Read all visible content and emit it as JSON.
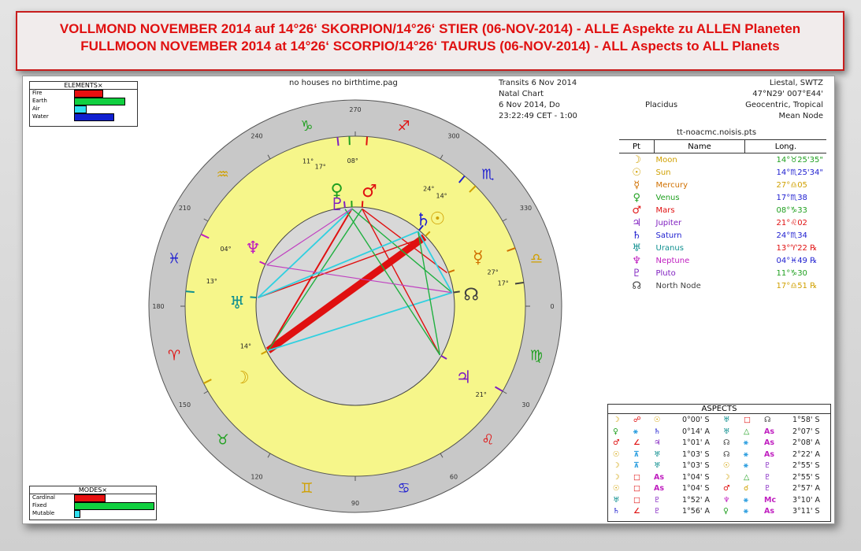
{
  "banner": {
    "line1": "VOLLMOND NOVEMBER 2014 auf 14°26‘ SKORPION/14°26‘ STIER (06-NOV-2014) - ALLE Aspekte zu ALLEN Planeten",
    "line2": "FULLMOON NOVEMBER 2014 at 14°26‘ SCORPIO/14°26‘ TAURUS (06-NOV-2014) - ALL Aspects to ALL Planets"
  },
  "chart_header": {
    "filename": "no houses no birthtime.pag",
    "left_lines": [
      "Transits 6 Nov 2014",
      "Natal Chart",
      "6 Nov 2014, Do",
      "23:22:49 CET - 1:00"
    ],
    "house_system": "Placidus",
    "right_lines": [
      "Liestal, SWTZ",
      "47°N29' 007°E44'",
      "Geocentric, Tropical",
      "Mean Node"
    ]
  },
  "elements": {
    "title": "ELEMENTS×",
    "items": [
      {
        "label": "Fire",
        "value": 0.42,
        "color": "#e81010"
      },
      {
        "label": "Earth",
        "value": 0.75,
        "color": "#10d040"
      },
      {
        "label": "Air",
        "value": 0.17,
        "color": "#30e0f0"
      },
      {
        "label": "Water",
        "value": 0.58,
        "color": "#1020d0"
      }
    ]
  },
  "modes": {
    "title": "MODES×",
    "items": [
      {
        "label": "Cardinal",
        "value": 0.38,
        "color": "#e81010"
      },
      {
        "label": "Fixed",
        "value": 1.0,
        "color": "#10d040"
      },
      {
        "label": "Mutable",
        "value": 0.06,
        "color": "#30e0f0"
      }
    ]
  },
  "wheel": {
    "degree_labels": [
      "270",
      "300",
      "330",
      "0",
      "30",
      "60",
      "90",
      "120",
      "150",
      "180",
      "210",
      "240"
    ],
    "signs": [
      {
        "glyph": "♈",
        "color": "#e01010"
      },
      {
        "glyph": "♉",
        "color": "#20a020"
      },
      {
        "glyph": "♊",
        "color": "#d0a000"
      },
      {
        "glyph": "♋",
        "color": "#2020d0"
      },
      {
        "glyph": "♌",
        "color": "#e01010"
      },
      {
        "glyph": "♍",
        "color": "#20a020"
      },
      {
        "glyph": "♎",
        "color": "#d0a000"
      },
      {
        "glyph": "♏",
        "color": "#2020d0"
      },
      {
        "glyph": "♐",
        "color": "#e01010"
      },
      {
        "glyph": "♑",
        "color": "#20a020"
      },
      {
        "glyph": "♒",
        "color": "#d0a000"
      },
      {
        "glyph": "♓",
        "color": "#2020d0"
      }
    ],
    "planets": [
      {
        "name": "Moon",
        "glyph": "☽",
        "deg": "14°",
        "color": "#d0a000"
      },
      {
        "name": "Sun",
        "glyph": "☉",
        "deg": "14°",
        "color": "#d0a000"
      },
      {
        "name": "Mercury",
        "glyph": "☿",
        "deg": "27°",
        "color": "#d07000"
      },
      {
        "name": "Venus",
        "glyph": "♀",
        "deg": "17°",
        "color": "#20a020"
      },
      {
        "name": "Mars",
        "glyph": "♂",
        "deg": "08°",
        "color": "#e01010"
      },
      {
        "name": "Jupiter",
        "glyph": "♃",
        "deg": "21°",
        "color": "#8020c0"
      },
      {
        "name": "Saturn",
        "glyph": "♄",
        "deg": "24°",
        "color": "#2020d0"
      },
      {
        "name": "Uranus",
        "glyph": "♅",
        "deg": "13°",
        "color": "#109090"
      },
      {
        "name": "Neptune",
        "glyph": "♆",
        "deg": "04°",
        "color": "#c020c0"
      },
      {
        "name": "Pluto",
        "glyph": "♇",
        "deg": "11°",
        "color": "#8020c0"
      },
      {
        "name": "North Node",
        "glyph": "☊",
        "deg": "17°",
        "color": "#404040"
      }
    ]
  },
  "planet_table": {
    "title": "tt-noacmc.noisis.pts",
    "headers": [
      "Pt",
      "Name",
      "Long."
    ],
    "rows": [
      {
        "glyph": "☽",
        "name": "Moon",
        "long": "14°♉25'35\"",
        "color": "#d0a000",
        "lcolor": "#20a020"
      },
      {
        "glyph": "☉",
        "name": "Sun",
        "long": "14°♏25'34\"",
        "color": "#d0a000",
        "lcolor": "#2020d0"
      },
      {
        "glyph": "☿",
        "name": "Mercury",
        "long": "27°♎05",
        "color": "#d07000",
        "lcolor": "#d0a000"
      },
      {
        "glyph": "♀",
        "name": "Venus",
        "long": "17°♏38",
        "color": "#20a020",
        "lcolor": "#2020d0"
      },
      {
        "glyph": "♂",
        "name": "Mars",
        "long": "08°♑33",
        "color": "#e01010",
        "lcolor": "#20a020"
      },
      {
        "glyph": "♃",
        "name": "Jupiter",
        "long": "21°♌02",
        "color": "#8020c0",
        "lcolor": "#e01010"
      },
      {
        "glyph": "♄",
        "name": "Saturn",
        "long": "24°♏34",
        "color": "#2020d0",
        "lcolor": "#2020d0"
      },
      {
        "glyph": "♅",
        "name": "Uranus",
        "long": "13°♈22 ℞",
        "color": "#109090",
        "lcolor": "#e01010"
      },
      {
        "glyph": "♆",
        "name": "Neptune",
        "long": "04°♓49 ℞",
        "color": "#c020c0",
        "lcolor": "#2020d0"
      },
      {
        "glyph": "♇",
        "name": "Pluto",
        "long": "11°♑30",
        "color": "#8020c0",
        "lcolor": "#20a020"
      },
      {
        "glyph": "☊",
        "name": "North Node",
        "long": "17°♎51 ℞",
        "color": "#404040",
        "lcolor": "#d0a000"
      }
    ]
  },
  "aspects": {
    "title": "ASPECTS",
    "left": [
      [
        "☽",
        "☍",
        "☉",
        "0°00' S"
      ],
      [
        "♀",
        "⚹",
        "♄",
        "0°14' A"
      ],
      [
        "♂",
        "∠",
        "♃",
        "1°01' A"
      ],
      [
        "☉",
        "⊼",
        "♅",
        "1°03' S"
      ],
      [
        "☽",
        "⊼",
        "♅",
        "1°03' S"
      ],
      [
        "☽",
        "□",
        "As",
        "1°04' S"
      ],
      [
        "☉",
        "□",
        "As",
        "1°04' S"
      ],
      [
        "♅",
        "□",
        "♇",
        "1°52' A"
      ],
      [
        "♄",
        "∠",
        "♇",
        "1°56' A"
      ]
    ],
    "right": [
      [
        "♅",
        "□",
        "☊",
        "1°58' S"
      ],
      [
        "♅",
        "△",
        "As",
        "2°07' S"
      ],
      [
        "☊",
        "⚹",
        "As",
        "2°08' A"
      ],
      [
        "☊",
        "⚹",
        "As",
        "2°22' A"
      ],
      [
        "☉",
        "⚹",
        "♇",
        "2°55' S"
      ],
      [
        "☽",
        "△",
        "♇",
        "2°55' S"
      ],
      [
        "♂",
        "☌",
        "♇",
        "2°57' A"
      ],
      [
        "♆",
        "⚹",
        "Mc",
        "3°10' A"
      ],
      [
        "♀",
        "⚹",
        "As",
        "3°11' S"
      ]
    ]
  }
}
